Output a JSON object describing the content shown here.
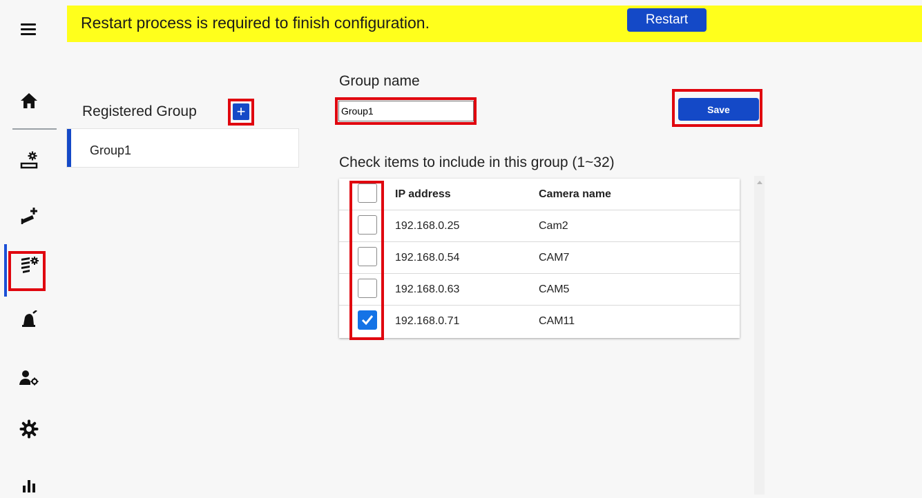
{
  "banner": {
    "message": "Restart process is required to finish configuration.",
    "restart_label": "Restart",
    "background": "#ffff1c"
  },
  "sidebar": {
    "items": [
      {
        "icon": "menu-icon"
      },
      {
        "icon": "home-icon"
      },
      {
        "icon": "device-settings-icon"
      },
      {
        "icon": "add-camera-icon"
      },
      {
        "icon": "camera-group-settings-icon",
        "active": true
      },
      {
        "icon": "alarm-settings-icon"
      },
      {
        "icon": "user-settings-icon"
      },
      {
        "icon": "gear-icon"
      },
      {
        "icon": "statistics-icon"
      }
    ]
  },
  "groups": {
    "title": "Registered Group",
    "add_label": "+",
    "items": [
      {
        "label": "Group1",
        "selected": true
      }
    ]
  },
  "form": {
    "group_name_label": "Group name",
    "group_name_value": "Group1",
    "save_label": "Save",
    "check_hint": "Check items to include in this group (1~32)"
  },
  "table": {
    "columns": [
      "IP address",
      "Camera name"
    ],
    "rows": [
      {
        "ip": "192.168.0.25",
        "name": "Cam2",
        "checked": false
      },
      {
        "ip": "192.168.0.54",
        "name": "CAM7",
        "checked": false
      },
      {
        "ip": "192.168.0.63",
        "name": "CAM5",
        "checked": false
      },
      {
        "ip": "192.168.0.71",
        "name": "CAM11",
        "checked": true
      }
    ]
  },
  "colors": {
    "accent": "#1449c7",
    "checkbox_checked": "#1473e6",
    "highlight_box": "#e0060f"
  }
}
